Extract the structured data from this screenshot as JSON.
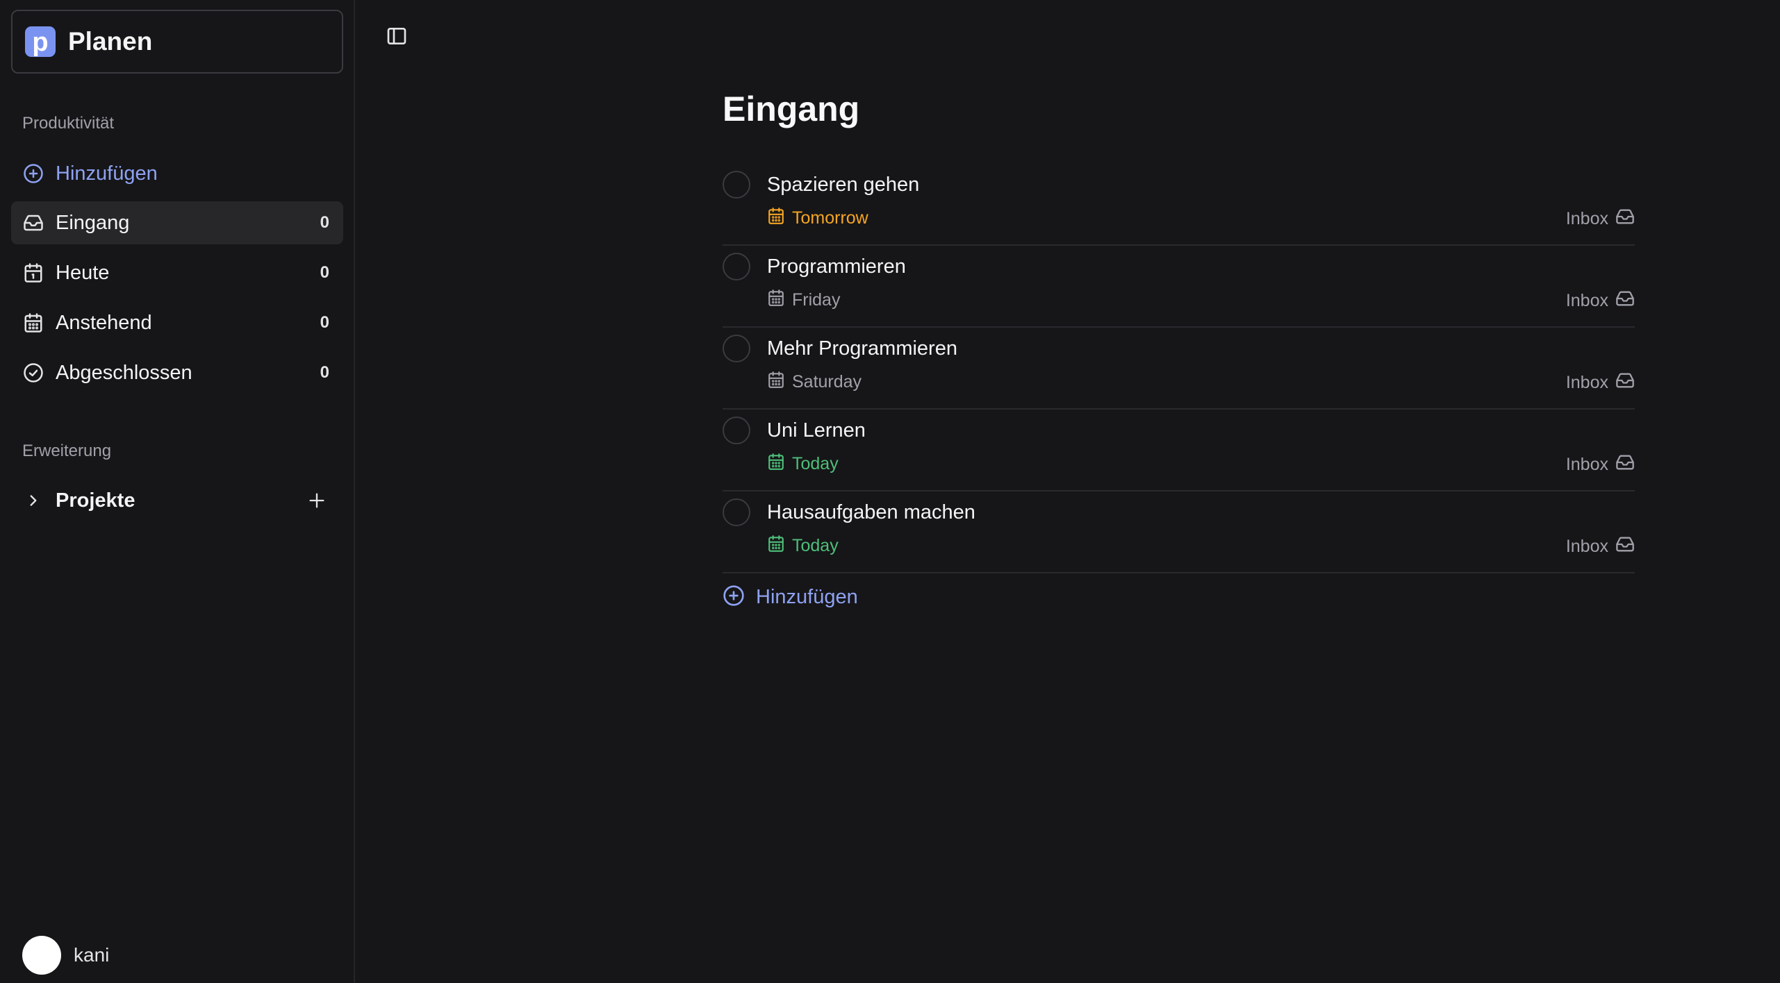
{
  "app": {
    "name": "Planen",
    "logo_letter": "p"
  },
  "sidebar": {
    "section_productivity": "Produktivität",
    "add_label": "Hinzufügen",
    "items": [
      {
        "label": "Eingang",
        "count": "0",
        "icon": "inbox-icon",
        "active": true
      },
      {
        "label": "Heute",
        "count": "0",
        "icon": "calendar-today-icon",
        "active": false
      },
      {
        "label": "Anstehend",
        "count": "0",
        "icon": "calendar-upcoming-icon",
        "active": false
      },
      {
        "label": "Abgeschlossen",
        "count": "0",
        "icon": "check-circle-icon",
        "active": false
      }
    ],
    "section_extension": "Erweiterung",
    "projects_label": "Projekte"
  },
  "user": {
    "name": "kani"
  },
  "main": {
    "title": "Eingang",
    "add_label": "Hinzufügen",
    "tasks": [
      {
        "title": "Spazieren gehen",
        "due": "Tomorrow",
        "due_color": "#f5a524",
        "project": "Inbox"
      },
      {
        "title": "Programmieren",
        "due": "Friday",
        "due_color": "#a1a1aa",
        "project": "Inbox"
      },
      {
        "title": "Mehr Programmieren",
        "due": "Saturday",
        "due_color": "#a1a1aa",
        "project": "Inbox"
      },
      {
        "title": "Uni Lernen",
        "due": "Today",
        "due_color": "#4ebf7a",
        "project": "Inbox"
      },
      {
        "title": "Hausaufgaben machen",
        "due": "Today",
        "due_color": "#4ebf7a",
        "project": "Inbox"
      }
    ]
  },
  "colors": {
    "background": "#161618",
    "accent": "#8ea2f2",
    "logo": "#7b93f0",
    "tomorrow": "#f5a524",
    "today": "#4ebf7a"
  }
}
